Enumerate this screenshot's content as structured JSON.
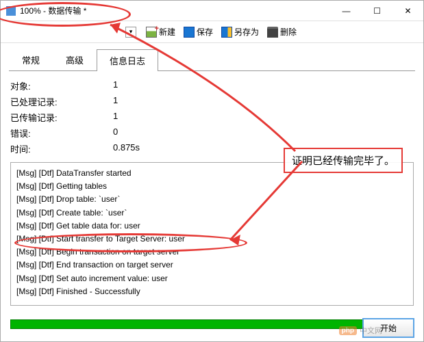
{
  "window": {
    "title": "100% - 数据传输 *"
  },
  "win_controls": {
    "min": "—",
    "max": "☐",
    "close": "✕"
  },
  "toolbar": {
    "new": "新建",
    "save": "保存",
    "saveas": "另存为",
    "delete": "删除"
  },
  "tabs": {
    "general": "常规",
    "advanced": "高级",
    "log": "信息日志"
  },
  "stats": {
    "object_label": "对象:",
    "object_value": "1",
    "processed_label": "已处理记录:",
    "processed_value": "1",
    "transferred_label": "已传输记录:",
    "transferred_value": "1",
    "error_label": "错误:",
    "error_value": "0",
    "time_label": "时间:",
    "time_value": "0.875s"
  },
  "log_lines": [
    "[Msg] [Dtf] DataTransfer started",
    "[Msg] [Dtf] Getting tables",
    "[Msg] [Dtf] Drop table: `user`",
    "[Msg] [Dtf] Create table: `user`",
    "[Msg] [Dtf] Get table data for: user",
    "[Msg] [Dtf] Start transfer to Target Server: user",
    "[Msg] [Dtf] Begin transaction on target server",
    "[Msg] [Dtf] End transaction on target server",
    "[Msg] [Dtf] Set auto increment value: user",
    "[Msg] [Dtf] Finished - Successfully"
  ],
  "buttons": {
    "start": "开始"
  },
  "annotation": {
    "text": "证明已经传输完毕了。"
  },
  "watermark": {
    "logo": "php",
    "text": "中文网"
  }
}
